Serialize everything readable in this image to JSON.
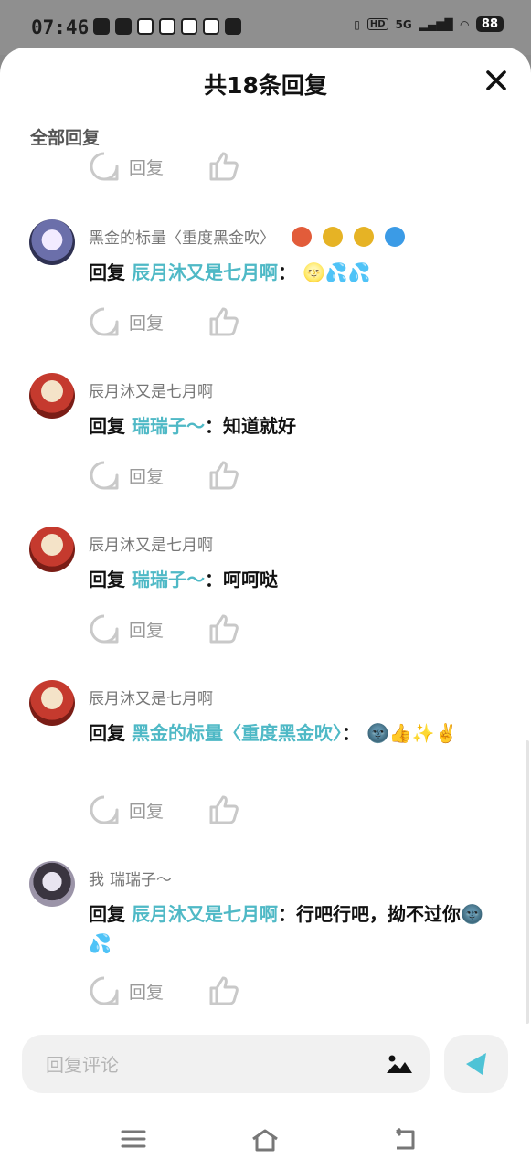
{
  "status_bar": {
    "time": "07:46",
    "network": "5G",
    "battery": "88"
  },
  "header": {
    "title": "共18条回复"
  },
  "section_label": "全部回复",
  "actions": {
    "reply_label": "回复"
  },
  "comments": [
    {
      "username": "黑金的标量〈重度黑金吹〉",
      "prefix": "回复",
      "mention": "辰月沐又是七月啊",
      "separator": "：",
      "text": "",
      "emojis": "🌝💦💦",
      "badges": [
        "#e25c3a",
        "#e6b325",
        "#e6b325",
        "#3b9be6"
      ]
    },
    {
      "username": "辰月沐又是七月啊",
      "prefix": "回复",
      "mention": "瑞瑞子～",
      "separator": "：",
      "text": "知道就好",
      "emojis": ""
    },
    {
      "username": "辰月沐又是七月啊",
      "prefix": "回复",
      "mention": "瑞瑞子～",
      "separator": "：",
      "text": "呵呵哒",
      "emojis": ""
    },
    {
      "username": "辰月沐又是七月啊",
      "prefix": "回复",
      "mention": "黑金的标量〈重度黑金吹〉",
      "separator": "：",
      "text": "",
      "emojis": "🌚👍✨✌️"
    },
    {
      "me_tag": "我",
      "username": "瑞瑞子～",
      "prefix": "回复",
      "mention": "辰月沐又是七月啊",
      "separator": "：",
      "text": "行吧行吧，拗不过你",
      "emojis": "🌚💦"
    }
  ],
  "input": {
    "placeholder": "回复评论",
    "value": ""
  },
  "colors": {
    "mention": "#4fb9c6",
    "send": "#4fc3d6",
    "muted": "#9a9a9a"
  }
}
